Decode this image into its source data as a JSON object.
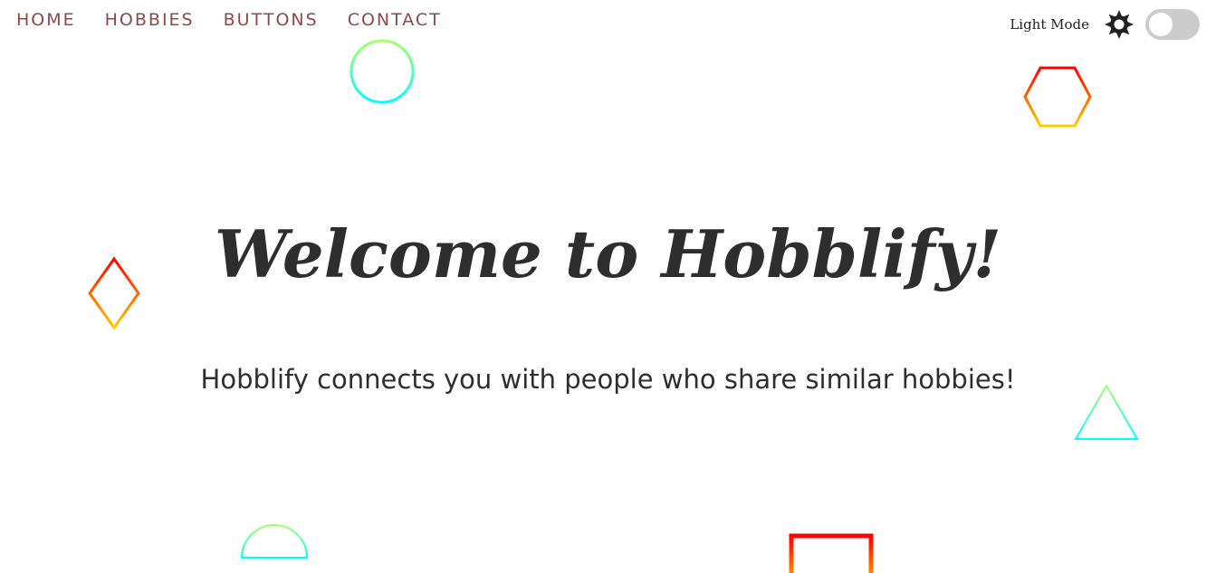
{
  "nav": {
    "items": [
      {
        "label": "HOME"
      },
      {
        "label": "HOBBIES"
      },
      {
        "label": "BUTTONS"
      },
      {
        "label": "CONTACT"
      }
    ]
  },
  "mode": {
    "label": "Light Mode",
    "icon": "sun-icon",
    "toggle_on": false
  },
  "hero": {
    "title": "Welcome to Hobblify!",
    "subtitle": "Hobblify connects you with people who share similar hobbies!"
  },
  "colors": {
    "nav_text": "#8b4a4a",
    "heading": "#2e2e2e",
    "toggle_track": "#cccccc",
    "gradient_warm_start": "#ff0000",
    "gradient_warm_end": "#ffcc00",
    "gradient_cool_start": "#aaff66",
    "gradient_cool_end": "#00ffff"
  },
  "decorations": [
    {
      "name": "circle-outline"
    },
    {
      "name": "hexagon-outline"
    },
    {
      "name": "diamond-outline"
    },
    {
      "name": "triangle-outline"
    },
    {
      "name": "half-circle-outline"
    },
    {
      "name": "square-outline"
    }
  ]
}
